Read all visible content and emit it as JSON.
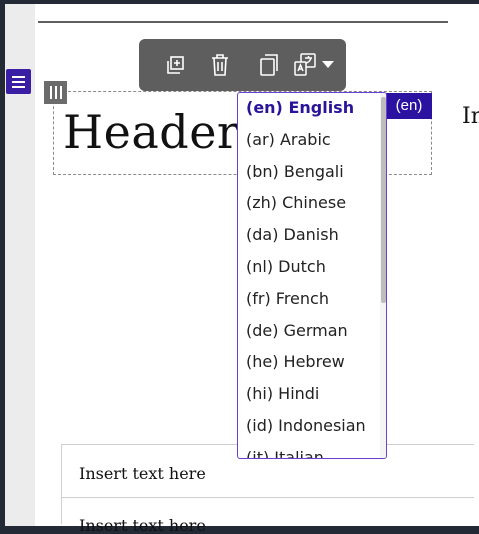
{
  "editor": {
    "header_text": "Header",
    "language_badge": "(en)",
    "cut_text": "In",
    "cell_1": "Insert text here",
    "cell_2": "Insert text here"
  },
  "toolbar": {
    "icons": [
      "duplicate-icon",
      "trash-icon",
      "copy-icon",
      "translate-icon",
      "caret-down-icon"
    ]
  },
  "language_dropdown": {
    "selected": "(en) English",
    "options": [
      "(en) English",
      "(ar) Arabic",
      "(bn) Bengali",
      "(zh) Chinese",
      "(da) Danish",
      "(nl) Dutch",
      "(fr) French",
      "(de) German",
      "(he) Hebrew",
      "(hi) Hindi",
      "(id) Indonesian",
      "(it) Italian"
    ]
  },
  "colors": {
    "accent": "#2c12a0",
    "toolbar_bg": "#5e5e5e",
    "dropdown_border": "#6b3fd1"
  }
}
